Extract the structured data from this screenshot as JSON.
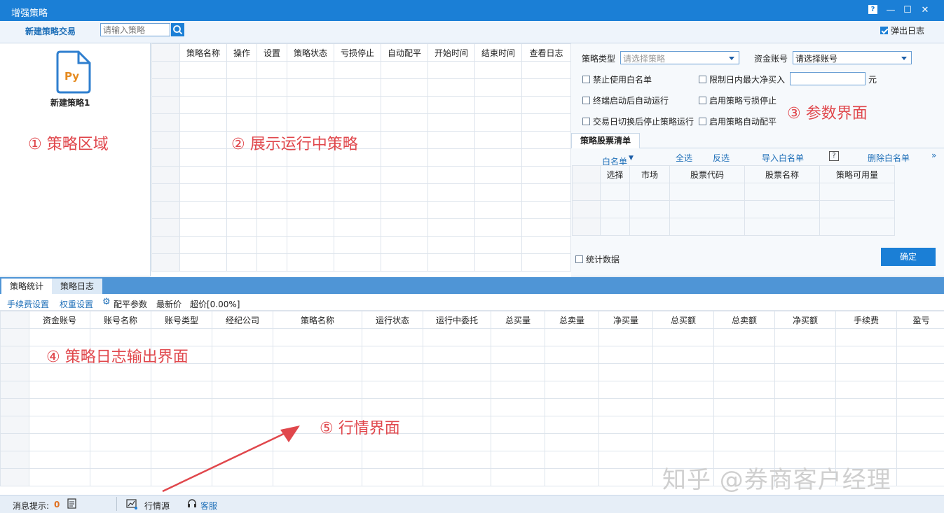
{
  "window": {
    "title": "增强策略"
  },
  "toolbar": {
    "new_trade": "新建策略交易",
    "search_placeholder": "请输入策略",
    "popup_log": "弹出日志"
  },
  "strategy_area": {
    "icon_text": "Py",
    "item_label": "新建策略1"
  },
  "running_table": {
    "columns": [
      "策略名称",
      "操作",
      "设置",
      "策略状态",
      "亏损停止",
      "自动配平",
      "开始时间",
      "结束时间",
      "查看日志"
    ]
  },
  "params": {
    "strategy_type_label": "策略类型",
    "strategy_type_placeholder": "请选择策略",
    "account_label": "资金账号",
    "account_placeholder": "请选择账号",
    "no_whitelist": "禁止使用白名单",
    "limit_daily": "限制日内最大净买入",
    "unit": "元",
    "auto_run": "终端启动后自动运行",
    "loss_stop": "启用策略亏损停止",
    "trade_day_stop": "交易日切换后停止策略运行",
    "auto_balance": "启用策略自动配平",
    "stock_list_tab": "策略股票清单",
    "whitelist": "白名单",
    "select_all": "全选",
    "invert": "反选",
    "import_whitelist": "导入白名单",
    "help": "?",
    "delete_whitelist": "删除白名单",
    "more": "»",
    "stock_columns": [
      "选择",
      "市场",
      "股票代码",
      "股票名称",
      "策略可用量"
    ],
    "stats_data": "统计数据",
    "confirm": "确定"
  },
  "bottom_tabs": {
    "stats": "策略统计",
    "log": "策略日志"
  },
  "bottom_toolbar": {
    "fee": "手续费设置",
    "weight": "权重设置",
    "balance_params": "配平参数",
    "last_price": "最新价",
    "over_price": "超价[0.00%]"
  },
  "stats_table": {
    "columns": [
      "资金账号",
      "账号名称",
      "账号类型",
      "经纪公司",
      "策略名称",
      "运行状态",
      "运行中委托",
      "总买量",
      "总卖量",
      "净买量",
      "总买额",
      "总卖额",
      "净买额",
      "手续费",
      "盈亏"
    ]
  },
  "annotations": {
    "a1": "① 策略区域",
    "a2": "② 展示运行中策略",
    "a3": "③ 参数界面",
    "a4": "④ 策略日志输出界面",
    "a5": "⑤ 行情界面"
  },
  "statusbar": {
    "msg_label": "消息提示:",
    "msg_count": "0",
    "market_source": "行情源",
    "service": "客服"
  },
  "watermark": "知乎 @券商客户经理",
  "colors": {
    "title_bar": "#1b7fd6",
    "annotation": "#e0474c",
    "link": "#1e6fb8"
  }
}
